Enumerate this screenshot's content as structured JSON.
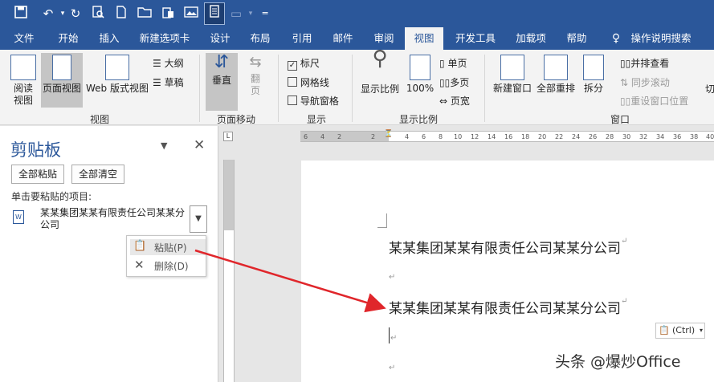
{
  "tabs": [
    "文件",
    "开始",
    "插入",
    "新建选项卡",
    "设计",
    "布局",
    "引用",
    "邮件",
    "审阅",
    "视图",
    "开发工具",
    "加载项",
    "帮助",
    "操作说明搜索"
  ],
  "ribbon": {
    "views": {
      "read": "阅读\n视图",
      "print": "页面视图",
      "web": "Web 版式视图",
      "outline": "大纲",
      "draft": "草稿",
      "group": "视图"
    },
    "pagemove": {
      "vertical": "垂直",
      "flip": "翻\n页",
      "group": "页面移动"
    },
    "show": {
      "ruler": "标尺",
      "grid": "网格线",
      "nav": "导航窗格",
      "group": "显示",
      "ruler_checked": true,
      "grid_checked": false,
      "nav_checked": false
    },
    "zoom": {
      "zoom": "显示比例",
      "pct": "100%",
      "one": "单页",
      "multi": "多页",
      "width": "页宽",
      "group": "显示比例"
    },
    "window": {
      "newwin": "新建窗口",
      "arrange": "全部重排",
      "split": "拆分",
      "side": "并排查看",
      "sync": "同步滚动",
      "reset": "重设窗口位置",
      "group": "窗口",
      "macro": "切"
    }
  },
  "pane": {
    "title": "剪贴板",
    "paste_all": "全部粘贴",
    "clear_all": "全部清空",
    "hint": "单击要粘贴的项目:",
    "item": "某某集团某某有限责任公司某某分公司"
  },
  "menu": {
    "paste": "粘贴(P)",
    "delete": "删除(D)"
  },
  "doc": {
    "line1": "某某集团某某有限责任公司某某分公司",
    "line2": "某某集团某某有限责任公司某某分公司",
    "ctrl": "(Ctrl)",
    "para_mark": "↵"
  },
  "watermark": "头条 @爆炒Office",
  "accent": "#2b579a"
}
